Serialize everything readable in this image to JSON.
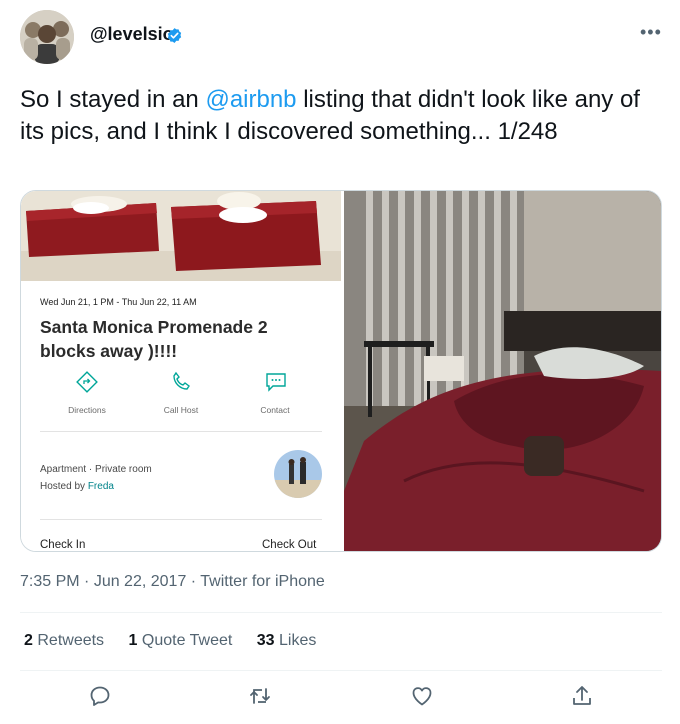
{
  "author": {
    "handle": "@levelsio",
    "verified": true
  },
  "tweet": {
    "text_before": "So I stayed in an ",
    "mention": "@airbnb",
    "text_after": " listing that didn't look like any of its pics, and I think I discovered something... 1/248"
  },
  "media": {
    "listing_card": {
      "dates": "Wed Jun 21, 1 PM - Thu Jun 22, 11 AM",
      "title": "Santa Monica Promenade 2 blocks away )!!!!",
      "actions": [
        {
          "label": "Directions",
          "icon": "directions-icon"
        },
        {
          "label": "Call Host",
          "icon": "phone-icon"
        },
        {
          "label": "Contact",
          "icon": "chat-icon"
        }
      ],
      "room_type": "Apartment · Private room",
      "hosted_by_prefix": "Hosted by ",
      "host_name": "Freda",
      "check_in": "Check In",
      "check_out": "Check Out"
    }
  },
  "meta": {
    "time": "7:35 PM",
    "date": "Jun 22, 2017",
    "source": "Twitter for iPhone"
  },
  "stats": {
    "retweets_count": "2",
    "retweets_label": "Retweets",
    "quotes_count": "1",
    "quotes_label": "Quote Tweet",
    "likes_count": "33",
    "likes_label": "Likes"
  },
  "colors": {
    "accent": "#1d9bf0",
    "secondary_text": "#536471",
    "host_link": "#00838a"
  }
}
